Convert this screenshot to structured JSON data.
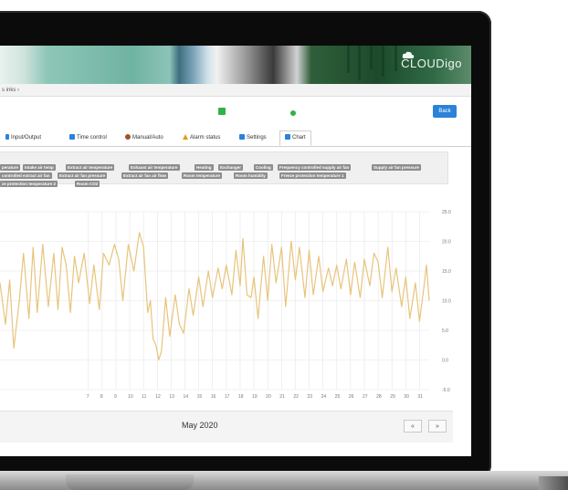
{
  "brand": {
    "name": "CLOUDigo"
  },
  "breadcrumb": {
    "text": "s inks  ›"
  },
  "header": {
    "back_label": "Back",
    "status_square_color": "#2fb24a",
    "status_dot_color": "#2fb24a"
  },
  "tabs": [
    {
      "label": "Input/Output",
      "icon": "io-icon",
      "color": "#2b82d9"
    },
    {
      "label": "Time control",
      "icon": "calendar-icon",
      "color": "#2b82d9"
    },
    {
      "label": "Manual/Auto",
      "icon": "hand-icon",
      "color": "#a0522d"
    },
    {
      "label": "Alarm status",
      "icon": "warning-icon",
      "color": "#e39a1e"
    },
    {
      "label": "Settings",
      "icon": "settings-icon",
      "color": "#2b82d9"
    },
    {
      "label": "Chart",
      "icon": "chart-icon",
      "color": "#2b82d9",
      "active": true
    }
  ],
  "legend": [
    "perature",
    "Intake air temp",
    "Extract air temperature",
    "Exhaust air temperature",
    "Heating",
    "Exchanger",
    "Cooling",
    "Frequency controlled supply air fan",
    "Supply air fan pressure",
    "controlled extract air fan",
    "Extract air fan pressure",
    "Extract air fan air flow",
    "Room temperature",
    "Room humidity",
    "Freeze protection temperature 1",
    "ze protection temperature 2",
    "Room CO2"
  ],
  "footer": {
    "month": "May 2020",
    "prev_label": "«",
    "next_label": "»"
  },
  "chart_data": {
    "type": "line",
    "xlim": [
      0.6,
      31.7
    ],
    "ylim": [
      -5.0,
      25.0
    ],
    "xticks": [
      "7",
      "8",
      "9",
      "10",
      "11",
      "12",
      "13",
      "14",
      "15",
      "16",
      "17",
      "18",
      "19",
      "20",
      "21",
      "22",
      "23",
      "24",
      "25",
      "26",
      "27",
      "28",
      "29",
      "30",
      "31"
    ],
    "yticks": [
      "25.0",
      "20.0",
      "15.0",
      "10.0",
      "5.0",
      "0.0",
      "-5.0"
    ],
    "grid": true,
    "series": [
      {
        "color": "#e8c47c",
        "points": [
          [
            0.6,
            13.0
          ],
          [
            1.0,
            6.0
          ],
          [
            1.3,
            13.5
          ],
          [
            1.6,
            2.0
          ],
          [
            2.0,
            10.0
          ],
          [
            2.3,
            18.0
          ],
          [
            2.7,
            7.0
          ],
          [
            3.0,
            19.0
          ],
          [
            3.3,
            8.0
          ],
          [
            3.7,
            19.5
          ],
          [
            4.1,
            9.0
          ],
          [
            4.5,
            18.0
          ],
          [
            4.8,
            8.5
          ],
          [
            5.1,
            19.0
          ],
          [
            5.4,
            16.0
          ],
          [
            5.7,
            8.0
          ],
          [
            6.0,
            17.5
          ],
          [
            6.3,
            13.0
          ],
          [
            6.7,
            18.0
          ],
          [
            7.1,
            9.5
          ],
          [
            7.4,
            16.0
          ],
          [
            7.8,
            8.5
          ],
          [
            8.1,
            18.0
          ],
          [
            8.5,
            16.0
          ],
          [
            8.9,
            19.5
          ],
          [
            9.2,
            17.0
          ],
          [
            9.5,
            10.0
          ],
          [
            9.9,
            19.5
          ],
          [
            10.3,
            15.0
          ],
          [
            10.7,
            21.5
          ],
          [
            11.0,
            19.0
          ],
          [
            11.3,
            8.0
          ],
          [
            11.5,
            10.0
          ],
          [
            11.7,
            3.5
          ],
          [
            11.9,
            2.5
          ],
          [
            12.1,
            0.0
          ],
          [
            12.3,
            1.5
          ],
          [
            12.6,
            10.5
          ],
          [
            12.9,
            4.0
          ],
          [
            13.3,
            11.0
          ],
          [
            13.6,
            6.0
          ],
          [
            13.9,
            4.5
          ],
          [
            14.3,
            12.0
          ],
          [
            14.6,
            7.5
          ],
          [
            15.0,
            14.0
          ],
          [
            15.3,
            9.0
          ],
          [
            15.7,
            15.0
          ],
          [
            16.0,
            10.5
          ],
          [
            16.4,
            15.5
          ],
          [
            16.7,
            12.0
          ],
          [
            17.0,
            16.0
          ],
          [
            17.4,
            11.0
          ],
          [
            17.7,
            18.5
          ],
          [
            18.0,
            12.5
          ],
          [
            18.2,
            20.5
          ],
          [
            18.5,
            11.0
          ],
          [
            18.8,
            10.5
          ],
          [
            19.0,
            14.0
          ],
          [
            19.3,
            7.0
          ],
          [
            19.7,
            17.5
          ],
          [
            20.0,
            10.0
          ],
          [
            20.3,
            19.5
          ],
          [
            20.6,
            13.0
          ],
          [
            21.0,
            19.0
          ],
          [
            21.3,
            9.0
          ],
          [
            21.7,
            20.0
          ],
          [
            22.0,
            13.5
          ],
          [
            22.3,
            19.0
          ],
          [
            22.7,
            10.5
          ],
          [
            23.0,
            18.5
          ],
          [
            23.3,
            11.0
          ],
          [
            23.7,
            17.5
          ],
          [
            24.0,
            11.5
          ],
          [
            24.4,
            15.5
          ],
          [
            24.7,
            12.5
          ],
          [
            25.0,
            16.0
          ],
          [
            25.3,
            12.0
          ],
          [
            25.7,
            17.0
          ],
          [
            26.0,
            11.0
          ],
          [
            26.3,
            16.5
          ],
          [
            26.7,
            10.5
          ],
          [
            27.0,
            17.0
          ],
          [
            27.4,
            12.5
          ],
          [
            27.7,
            18.0
          ],
          [
            28.0,
            16.5
          ],
          [
            28.3,
            10.5
          ],
          [
            28.7,
            19.0
          ],
          [
            29.0,
            11.5
          ],
          [
            29.3,
            15.5
          ],
          [
            29.7,
            9.0
          ],
          [
            30.0,
            14.0
          ],
          [
            30.3,
            7.0
          ],
          [
            30.7,
            13.0
          ],
          [
            31.0,
            6.5
          ],
          [
            31.3,
            12.0
          ],
          [
            31.5,
            16.0
          ],
          [
            31.7,
            10.0
          ]
        ]
      }
    ]
  }
}
